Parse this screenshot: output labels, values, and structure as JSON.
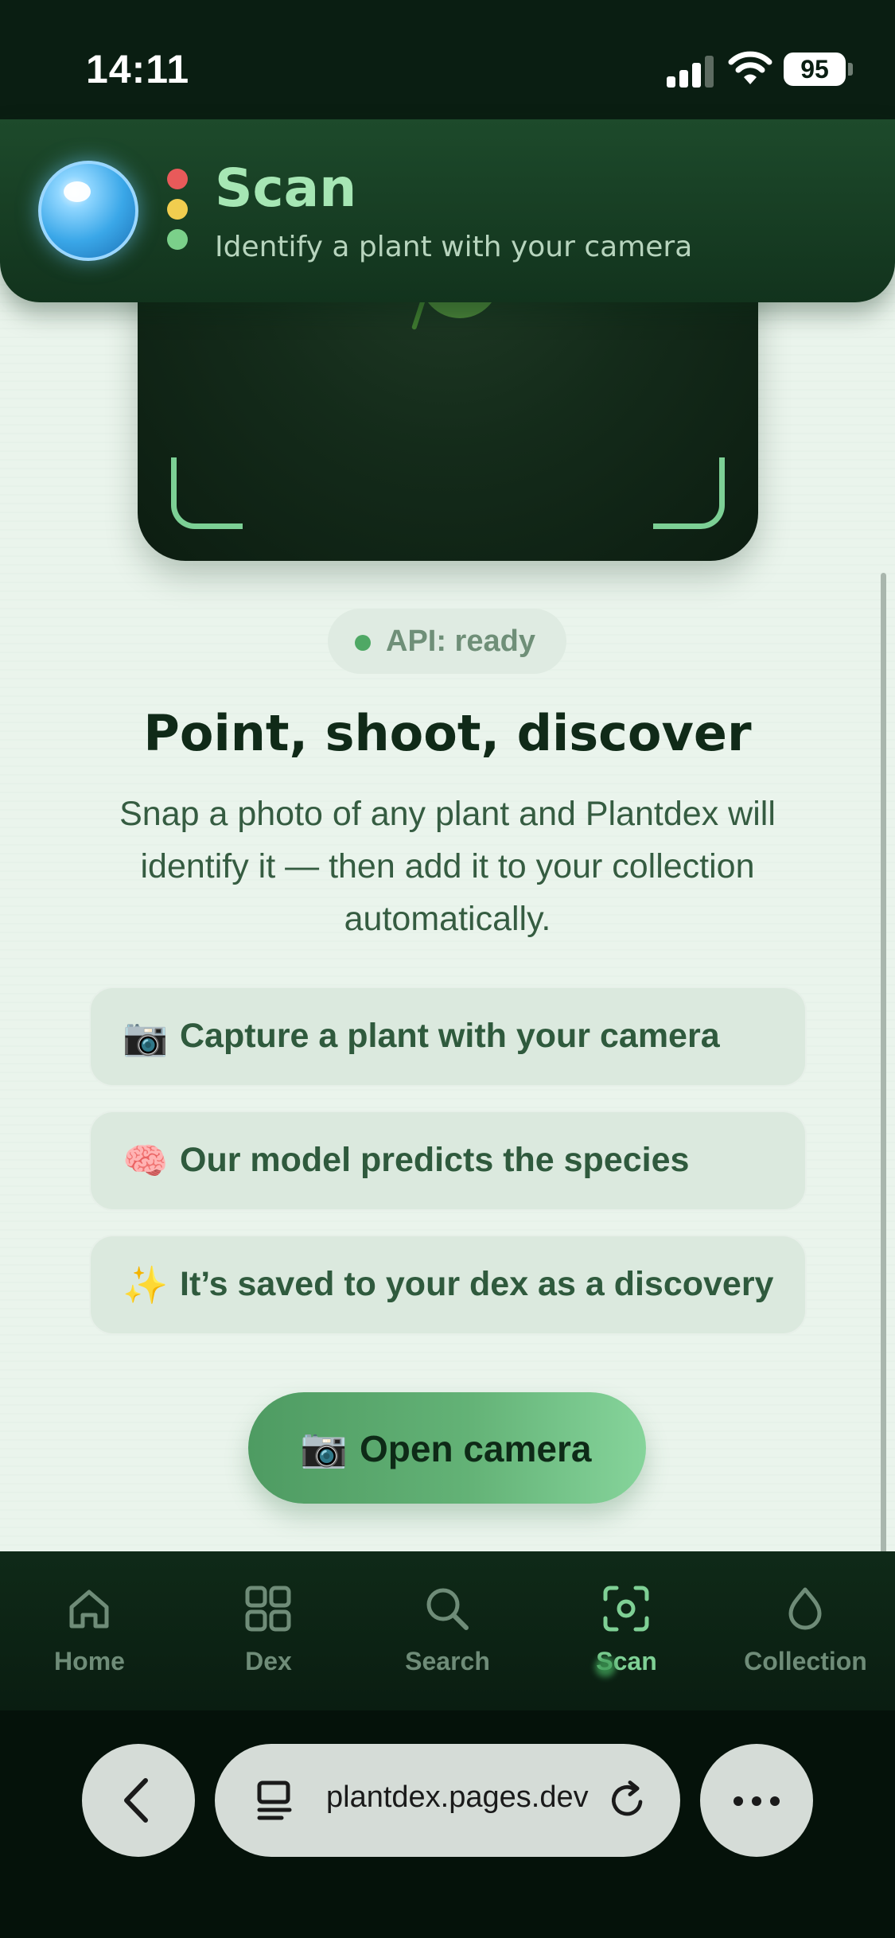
{
  "status_bar": {
    "time": "14:11",
    "battery": "95"
  },
  "header": {
    "title": "Scan",
    "subtitle": "Identify a plant with your camera"
  },
  "api_status": {
    "label": "API: ready",
    "color": "#4fa865"
  },
  "main": {
    "headline": "Point, shoot, discover",
    "description": "Snap a photo of any plant and Plantdex will identify it — then add it to your collection automatically.",
    "steps": [
      {
        "icon": "📷",
        "icon_name": "camera-icon",
        "label": "Capture a plant with your camera"
      },
      {
        "icon": "🧠",
        "icon_name": "brain-icon",
        "label": "Our model predicts the species"
      },
      {
        "icon": "✨",
        "icon_name": "sparkles-icon",
        "label": "It’s saved to your dex as a discovery"
      }
    ],
    "open_camera": {
      "icon": "📷",
      "label": "Open camera"
    }
  },
  "tabbar": {
    "items": [
      {
        "label": "Home",
        "icon": "home-icon"
      },
      {
        "label": "Dex",
        "icon": "grid-icon"
      },
      {
        "label": "Search",
        "icon": "search-icon"
      },
      {
        "label": "Scan",
        "icon": "scan-icon",
        "active": true
      },
      {
        "label": "Collection",
        "icon": "leaf-drop-icon"
      }
    ]
  },
  "browser": {
    "url": "plantdex.pages.dev"
  },
  "colors": {
    "accent": "#7fd095",
    "header_bg": "#12331d",
    "page_bg": "#eaf4ec",
    "button": "#63b276"
  }
}
